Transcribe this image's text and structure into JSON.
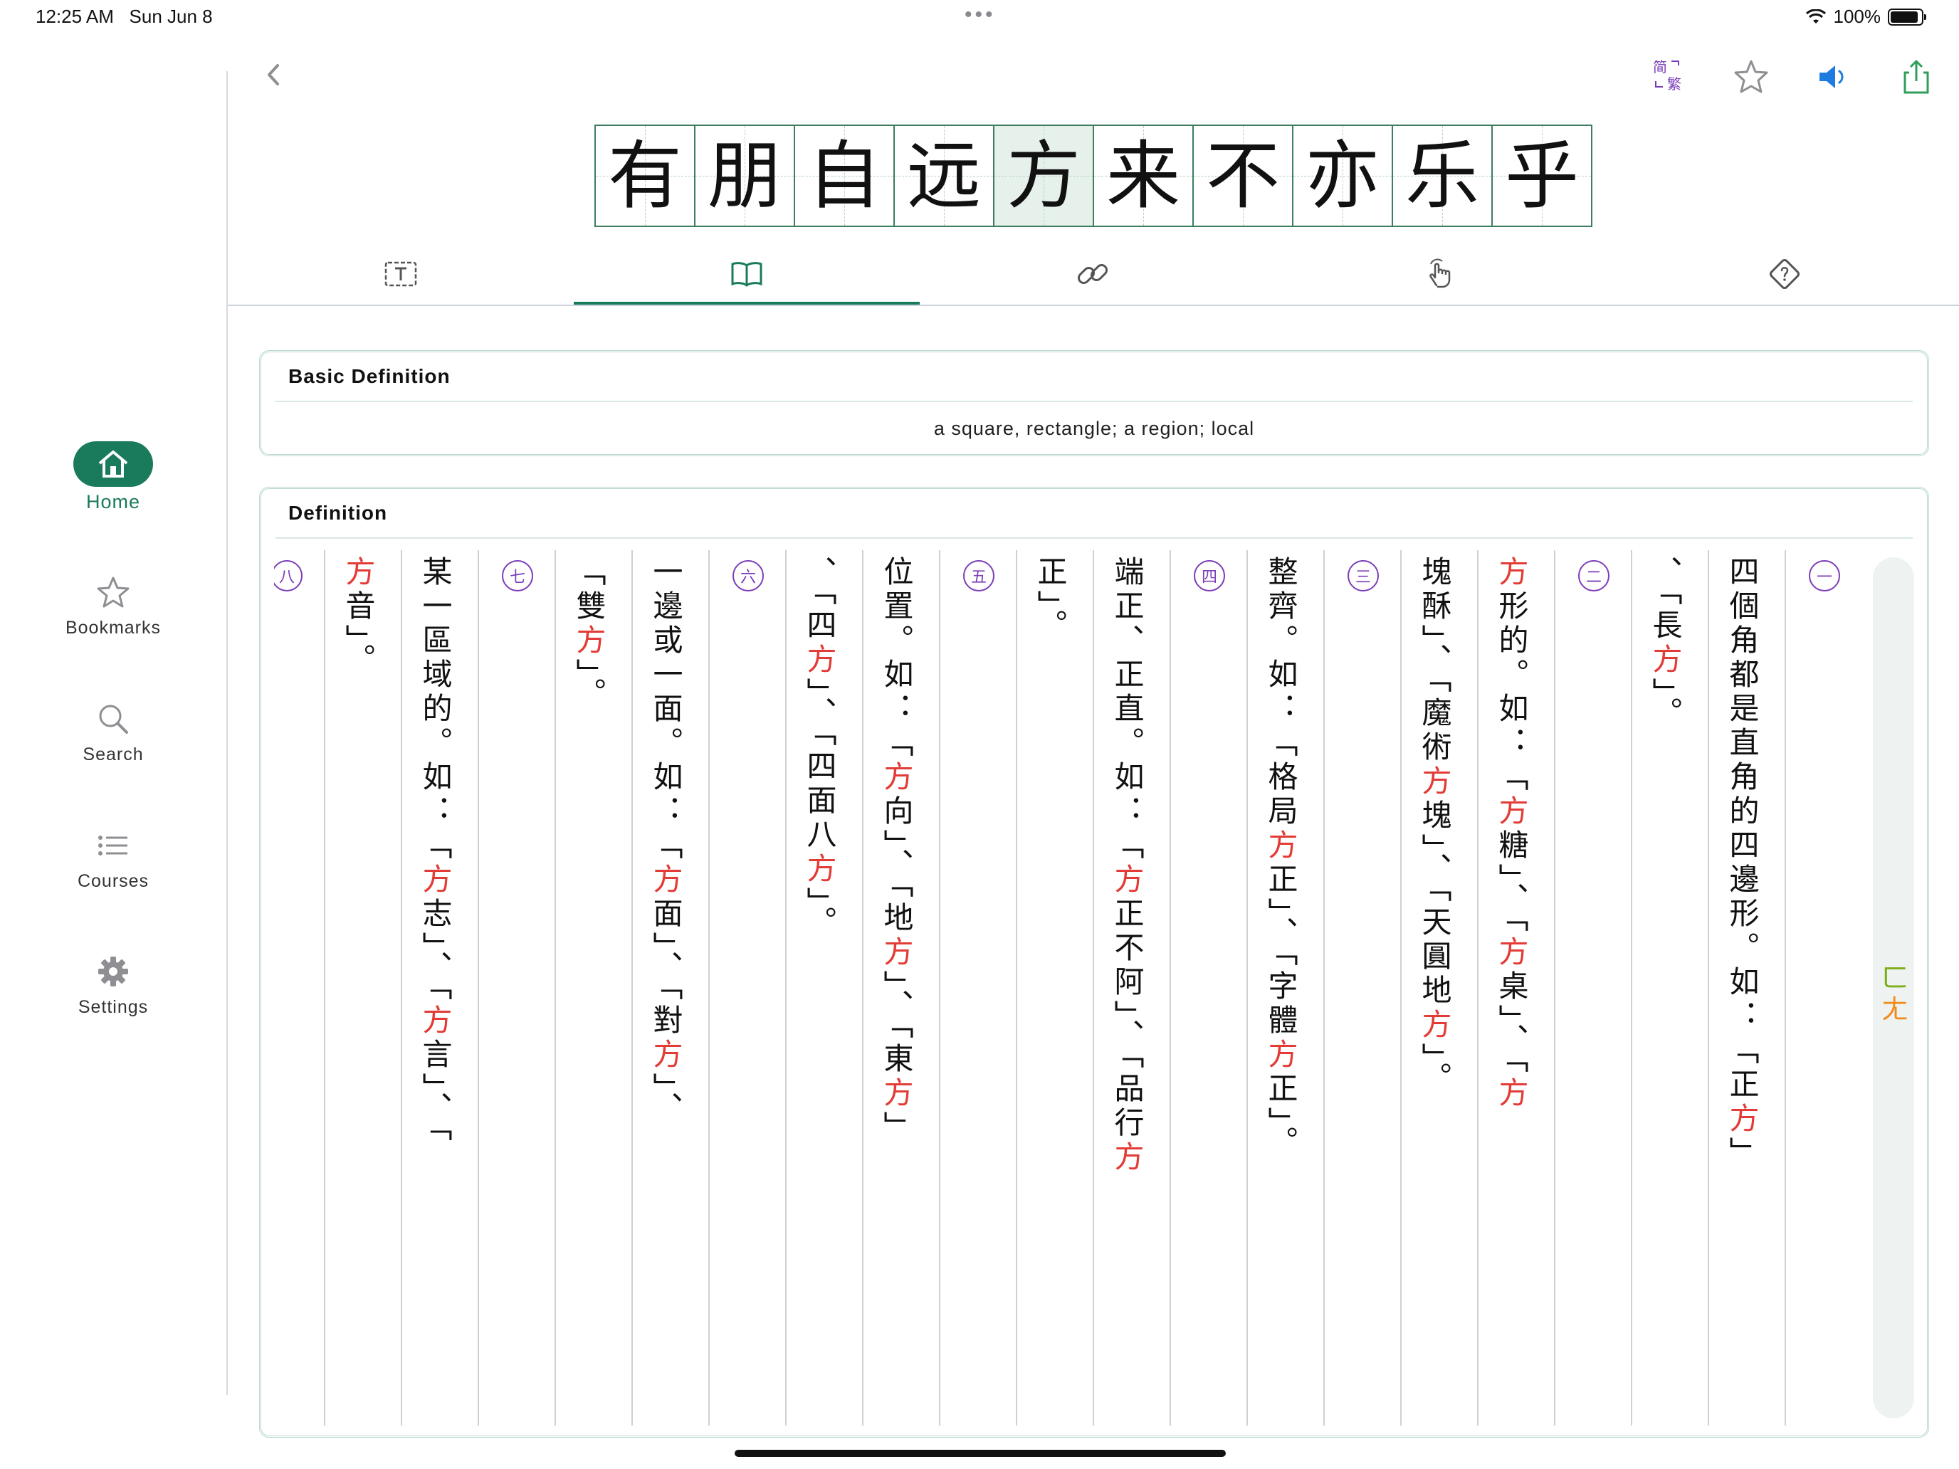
{
  "status": {
    "time": "12:25 AM",
    "date": "Sun Jun 8",
    "battery": "100%",
    "battery_level": 1.0
  },
  "sidebar": {
    "items": [
      {
        "label": "Home",
        "icon": "home-icon",
        "active": true
      },
      {
        "label": "Bookmarks",
        "icon": "star-icon"
      },
      {
        "label": "Search",
        "icon": "search-icon"
      },
      {
        "label": "Courses",
        "icon": "list-icon"
      },
      {
        "label": "Settings",
        "icon": "gear-icon"
      }
    ]
  },
  "toolbar": {
    "simp_label": "简",
    "trad_label": "繁",
    "accent": "#197a5c",
    "toggle_color": "#7a3db8"
  },
  "phrase": [
    "有",
    "朋",
    "自",
    "远",
    "方",
    "来",
    "不",
    "亦",
    "乐",
    "乎"
  ],
  "selected_index": 4,
  "tabs": [
    {
      "icon": "text-box-icon"
    },
    {
      "icon": "book-icon",
      "active": true
    },
    {
      "icon": "link-icon"
    },
    {
      "icon": "hand-tap-icon"
    },
    {
      "icon": "question-diamond-icon"
    }
  ],
  "basic": {
    "title": "Basic Definition",
    "text": "a square, rectangle; a region; local"
  },
  "definition": {
    "title": "Definition",
    "zhuyin_1": "ㄈ",
    "zhuyin_2": "ㄤ",
    "columns": [
      {
        "num": "一"
      },
      {
        "p1": "四個角都是直角的四邊形。如：「正",
        "r1": "方",
        "p2": "」"
      },
      {
        "p1": "、「長",
        "r1": "方",
        "p2": "」。"
      },
      {
        "num": "二"
      },
      {
        "r1": "方",
        "p1": "形的。如：「",
        "r2": "方",
        "p2": "糖」、「",
        "r3": "方",
        "p3": "桌」、「",
        "r4": "方"
      },
      {
        "p1": "塊酥」、「魔術",
        "r1": "方",
        "p2": "塊」、「天圓地",
        "r2": "方",
        "p3": "」。"
      },
      {
        "num": "三"
      },
      {
        "p1": "整齊。如：「格局",
        "r1": "方",
        "p2": "正」、「字體",
        "r2": "方",
        "p3": "正」。"
      },
      {
        "num": "四"
      },
      {
        "p1": "端正、正直。如：「",
        "r1": "方",
        "p2": "正不阿」、「品行",
        "r2": "方"
      },
      {
        "p1": "正」。"
      },
      {
        "num": "五"
      },
      {
        "p1": "位置。如：「",
        "r1": "方",
        "p2": "向」、「地",
        "r2": "方",
        "p3": "」、「東",
        "r3": "方",
        "p4": "」"
      },
      {
        "p1": "、「四",
        "r1": "方",
        "p2": "」、「四面八",
        "r2": "方",
        "p3": "」。"
      },
      {
        "num": "六"
      },
      {
        "p1": "一邊或一面。如：「",
        "r1": "方",
        "p2": "面」、「對",
        "r2": "方",
        "p3": "」、"
      },
      {
        "p1": "「雙",
        "r1": "方",
        "p2": "」。"
      },
      {
        "num": "七"
      },
      {
        "p1": "某一區域的。如：「",
        "r1": "方",
        "p2": "志」、「",
        "r2": "方",
        "p3": "言」、「"
      },
      {
        "r1": "方",
        "p1": "音」。"
      },
      {
        "num": "八"
      }
    ]
  }
}
